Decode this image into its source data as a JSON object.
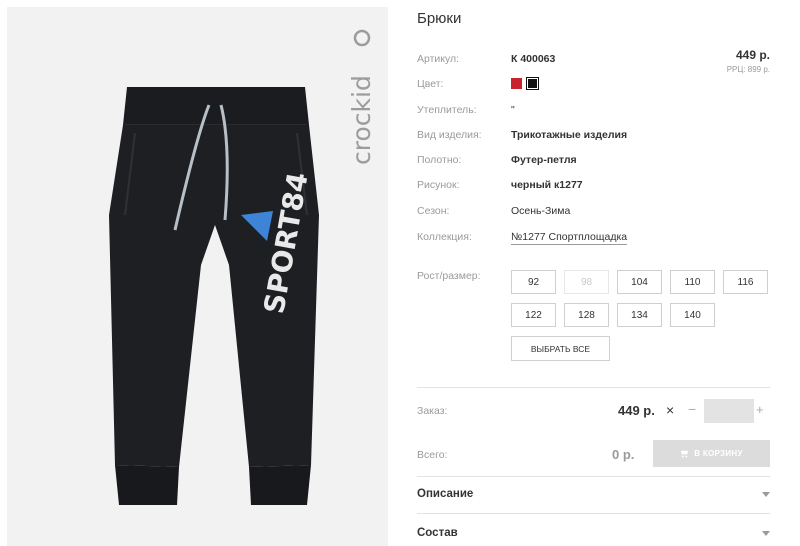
{
  "product": {
    "title": "Брюки",
    "price": "449 р.",
    "rrp": "РРЦ: 899 р."
  },
  "brand": {
    "logo_text": "crockid"
  },
  "image": {
    "print_text": "SPORT84"
  },
  "colors": {
    "accent_red": "#c8232d",
    "swatch_black": "#111111"
  },
  "specs": [
    {
      "label": "Артикул:",
      "value": "К 400063"
    },
    {
      "label": "Цвет:",
      "value": ""
    },
    {
      "label": "Утеплитель:",
      "value": "\""
    },
    {
      "label": "Вид изделия:",
      "value": "Трикотажные изделия"
    },
    {
      "label": "Полотно:",
      "value": "Футер-петля"
    },
    {
      "label": "Рисунок:",
      "value": "черный к1277"
    },
    {
      "label": "Сезон:",
      "value": "Осень-Зима"
    },
    {
      "label": "Коллекция:",
      "value": "№1277 Спортплощадка"
    }
  ],
  "sizes": {
    "label": "Рост/размер:",
    "items": [
      "92",
      "98",
      "104",
      "110",
      "116",
      "122",
      "128",
      "134",
      "140"
    ],
    "disabled": [
      "98"
    ],
    "select_all": "ВЫБРАТЬ ВСЕ"
  },
  "order": {
    "label": "Заказ:",
    "price": "449 р.",
    "times": "×",
    "minus": "−",
    "plus": "+",
    "qty_value": ""
  },
  "total": {
    "label": "Всего:",
    "value": "0 р.",
    "cart_button": "В КОРЗИНУ",
    "cart_icon": "cart-icon"
  },
  "sections": [
    {
      "label": "Описание"
    },
    {
      "label": "Состав"
    }
  ]
}
